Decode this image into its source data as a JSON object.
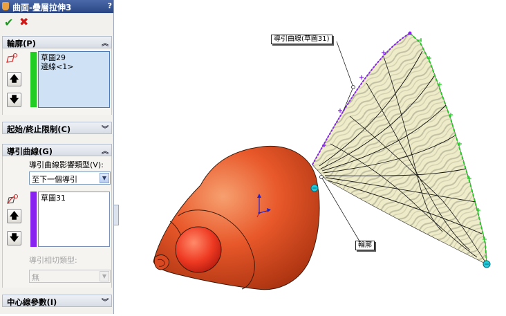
{
  "window": {
    "title": "曲面-疊層拉伸3",
    "help_label": "?"
  },
  "actions": {
    "ok_label": "✔",
    "cancel_label": "✖"
  },
  "profile_section": {
    "title": "輪廓(P)",
    "items": [
      "草圖29",
      "邊線<1>"
    ],
    "color": "#22cc22"
  },
  "start_end_section": {
    "title": "起始/終止限制(C)"
  },
  "guide_section": {
    "title": "導引曲線(G)",
    "influence_label": "導引曲線影響類型(V):",
    "influence_value": "至下一個導引",
    "items": [
      "草圖31"
    ],
    "color": "#8822ee",
    "tangency_label": "導引相切類型:",
    "tangency_value": "無"
  },
  "centerline_section": {
    "title": "中心線參數(I)"
  },
  "viewport": {
    "callout_guide": "導引曲線(草圖31)",
    "callout_profile": "輪廓"
  },
  "colors": {
    "body": "#e8582a",
    "surface": "#ecebc4",
    "profile_green": "#22cc22",
    "guide_purple": "#8822ee",
    "handle": "#22ccdd"
  }
}
